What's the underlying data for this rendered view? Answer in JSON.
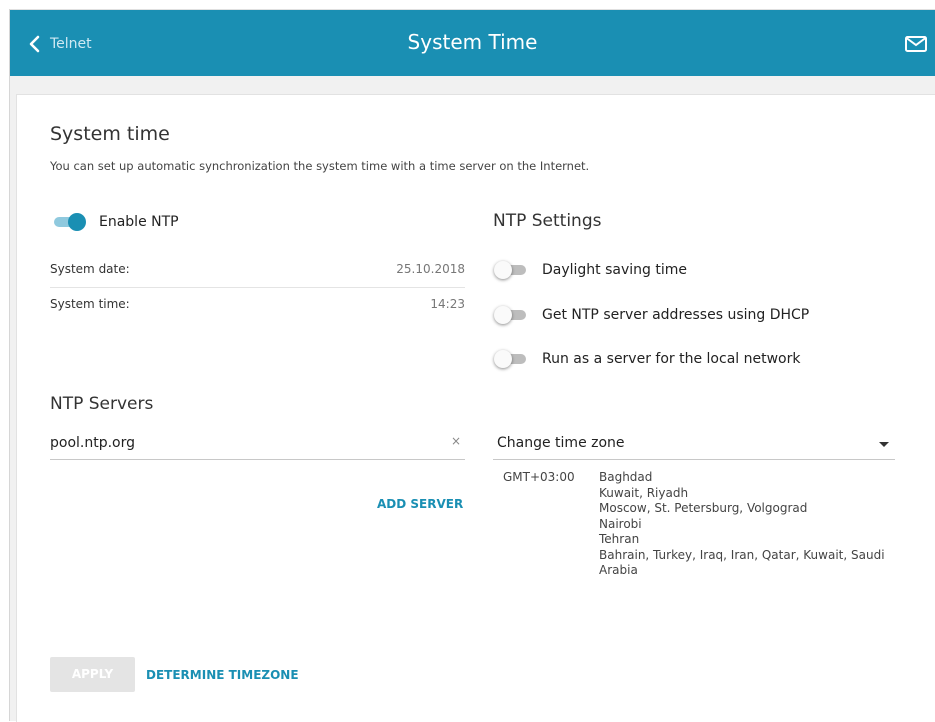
{
  "header": {
    "back_label": "Telnet",
    "title": "System Time",
    "back_icon": "chevron-left-icon",
    "mail_icon": "mail-icon"
  },
  "section": {
    "title": "System time",
    "description": "You can set up automatic synchronization the system time with a time server on the Internet."
  },
  "ntp_enable": {
    "label": "Enable NTP",
    "state": "on"
  },
  "system_info": {
    "date_label": "System date:",
    "date_value": "25.10.2018",
    "time_label": "System time:",
    "time_value": "14:23"
  },
  "ntp_settings": {
    "title": "NTP Settings",
    "daylight_label": "Daylight saving time",
    "dhcp_label": "Get NTP server addresses using DHCP",
    "server_label": "Run as a server for the local network"
  },
  "ntp_servers": {
    "title": "NTP Servers",
    "server_value": "pool.ntp.org",
    "clear_symbol": "×",
    "add_label": "ADD SERVER"
  },
  "timezone": {
    "select_label": "Change time zone",
    "offset": "GMT+03:00",
    "cities": [
      "Baghdad",
      "Kuwait, Riyadh",
      "Moscow, St. Petersburg, Volgograd",
      "Nairobi",
      "Tehran",
      "Bahrain, Turkey, Iraq, Iran, Qatar, Kuwait, Saudi Arabia"
    ]
  },
  "actions": {
    "apply_label": "APPLY",
    "determine_label": "DETERMINE TIMEZONE"
  },
  "colors": {
    "accent": "#1a8fb3",
    "background": "#f1f1f1",
    "disabled": "#e4e4e4"
  }
}
